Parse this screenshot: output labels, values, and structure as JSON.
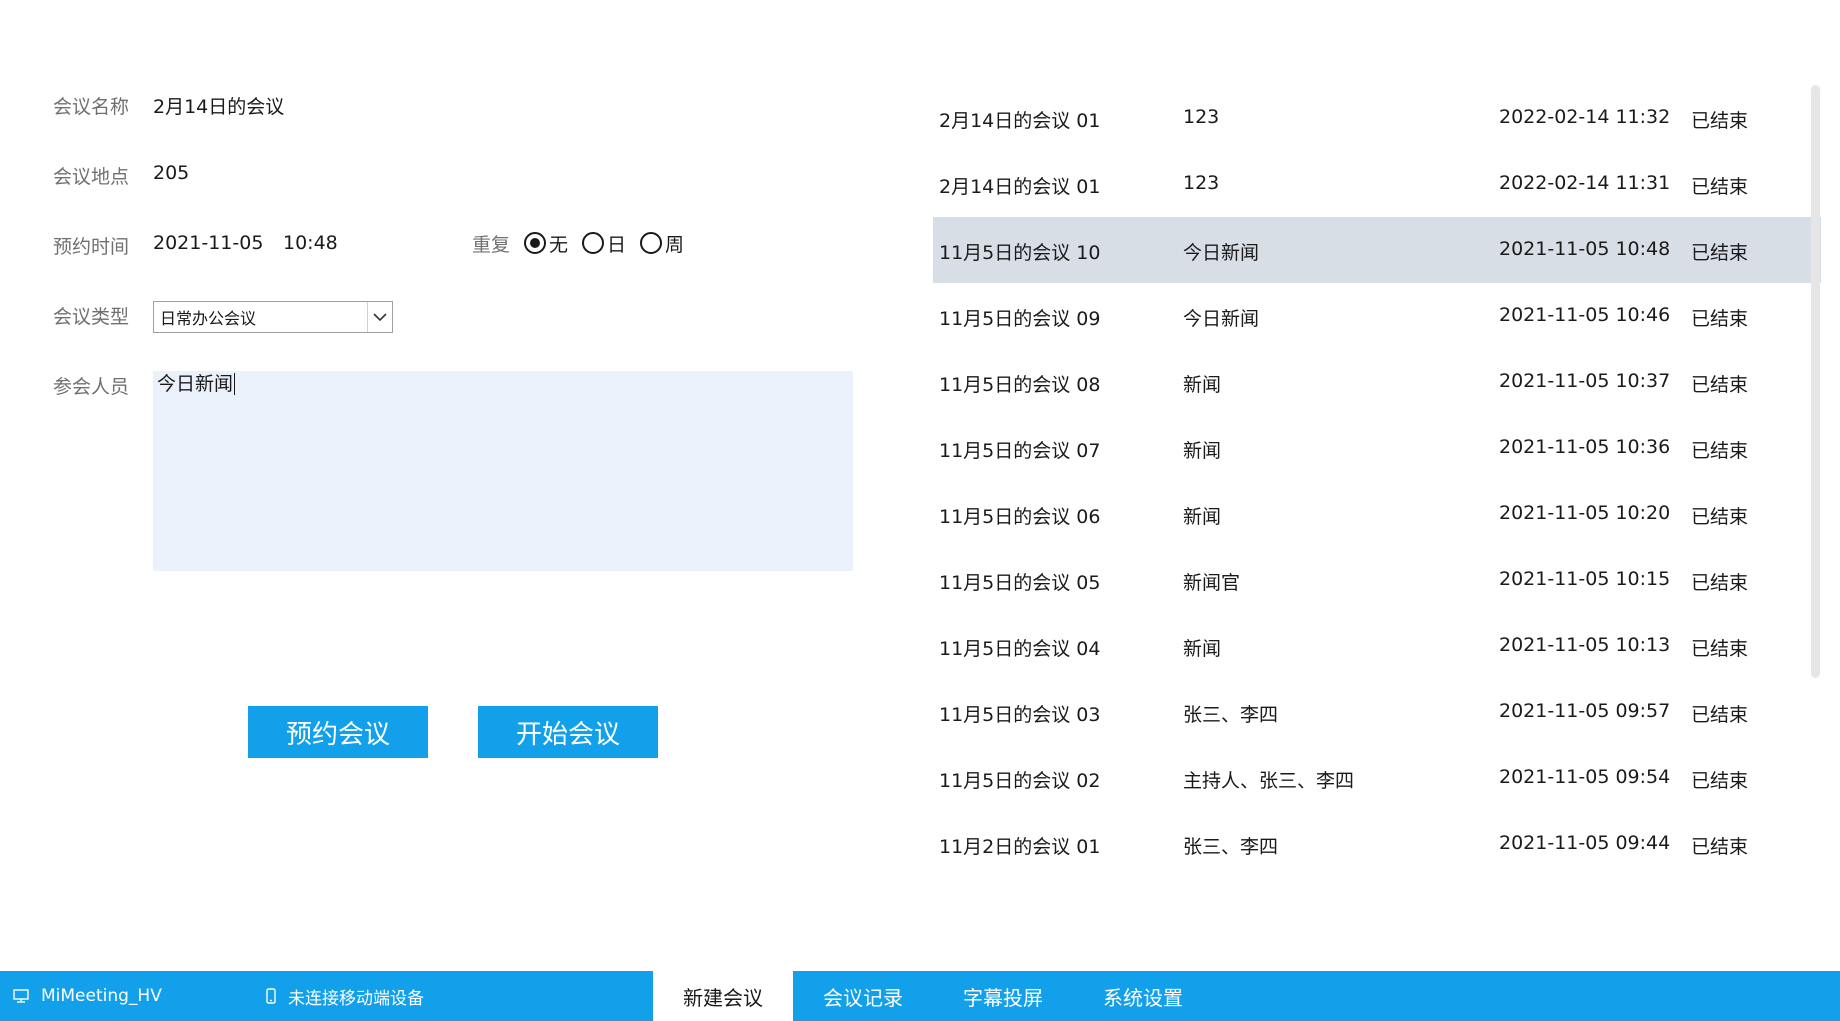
{
  "form": {
    "name_label": "会议名称",
    "name_value": "2月14日的会议",
    "location_label": "会议地点",
    "location_value": "205",
    "time_label": "预约时间",
    "date_value": "2021-11-05",
    "time_value": "10:48",
    "repeat_label": "重复",
    "repeat_options": [
      "无",
      "日",
      "周"
    ],
    "repeat_selected": "无",
    "type_label": "会议类型",
    "type_value": "日常办公会议",
    "attendees_label": "参会人员",
    "attendees_value": "今日新闻",
    "book_button": "预约会议",
    "start_button": "开始会议"
  },
  "meetings": [
    {
      "name": "2月14日的会议 01",
      "desc": "123",
      "time": "2022-02-14 11:32",
      "status": "已结束"
    },
    {
      "name": "2月14日的会议 01",
      "desc": "123",
      "time": "2022-02-14 11:31",
      "status": "已结束"
    },
    {
      "name": "11月5日的会议 10",
      "desc": "今日新闻",
      "time": "2021-11-05 10:48",
      "status": "已结束"
    },
    {
      "name": "11月5日的会议 09",
      "desc": "今日新闻",
      "time": "2021-11-05 10:46",
      "status": "已结束"
    },
    {
      "name": "11月5日的会议 08",
      "desc": "新闻",
      "time": "2021-11-05 10:37",
      "status": "已结束"
    },
    {
      "name": "11月5日的会议 07",
      "desc": "新闻",
      "time": "2021-11-05 10:36",
      "status": "已结束"
    },
    {
      "name": "11月5日的会议 06",
      "desc": "新闻",
      "time": "2021-11-05 10:20",
      "status": "已结束"
    },
    {
      "name": "11月5日的会议 05",
      "desc": "新闻官",
      "time": "2021-11-05 10:15",
      "status": "已结束"
    },
    {
      "name": "11月5日的会议 04",
      "desc": "新闻",
      "time": "2021-11-05 10:13",
      "status": "已结束"
    },
    {
      "name": "11月5日的会议 03",
      "desc": "张三、李四",
      "time": "2021-11-05 09:57",
      "status": "已结束"
    },
    {
      "name": "11月5日的会议 02",
      "desc": "主持人、张三、李四",
      "time": "2021-11-05 09:54",
      "status": "已结束"
    },
    {
      "name": "11月2日的会议 01",
      "desc": "张三、李四",
      "time": "2021-11-05 09:44",
      "status": "已结束"
    }
  ],
  "selected_meeting": 2,
  "statusbar": {
    "device_name": "MiMeeting_HV",
    "device_icon": "monitor-icon",
    "mobile_status": "未连接移动端设备",
    "mobile_icon": "phone-icon"
  },
  "tabs": [
    {
      "label": "新建会议",
      "active": true
    },
    {
      "label": "会议记录",
      "active": false
    },
    {
      "label": "字幕投屏",
      "active": false
    },
    {
      "label": "系统设置",
      "active": false
    }
  ],
  "colors": {
    "accent": "#13a0eb",
    "selected_row": "#d8dee6",
    "textarea_bg": "#eaf1fb"
  }
}
